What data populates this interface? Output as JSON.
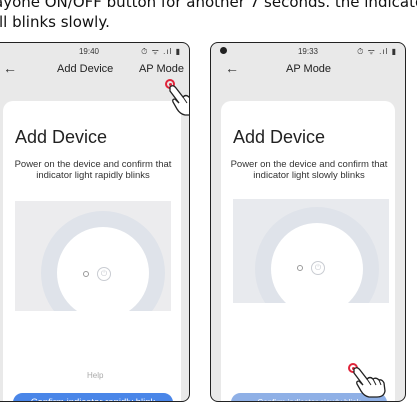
{
  "caption": {
    "line1": "ayone ON/OFF button for another 7 seconds. the indicator",
    "line2": "ll blinks slowly."
  },
  "left_phone": {
    "time": "19:40",
    "status_icons": "⏱ ᯤ .ıl ▮",
    "nav_back": "←",
    "nav_title": "Add Device",
    "nav_action": "AP Mode",
    "card_title": "Add Device",
    "instruction": "Power on the device and confirm that indicator light rapidly blinks",
    "help": "Help",
    "button": "Confirm indicator rapidly blink",
    "button_color": "#4a86e8"
  },
  "right_phone": {
    "time": "19:33",
    "status_icons": "⏱ ᯤ .ıl ▮",
    "nav_back": "←",
    "nav_title": "AP Mode",
    "card_title": "Add Device",
    "instruction": "Power on the device and confirm that indicator light slowly blinks",
    "button": "Confirm indicator slowly blink",
    "button_color": "#8fb0e6"
  },
  "icons": {
    "power": "⏻",
    "tap": "hand-pointer-icon"
  },
  "colors": {
    "tap_marker": "#e0243a"
  }
}
